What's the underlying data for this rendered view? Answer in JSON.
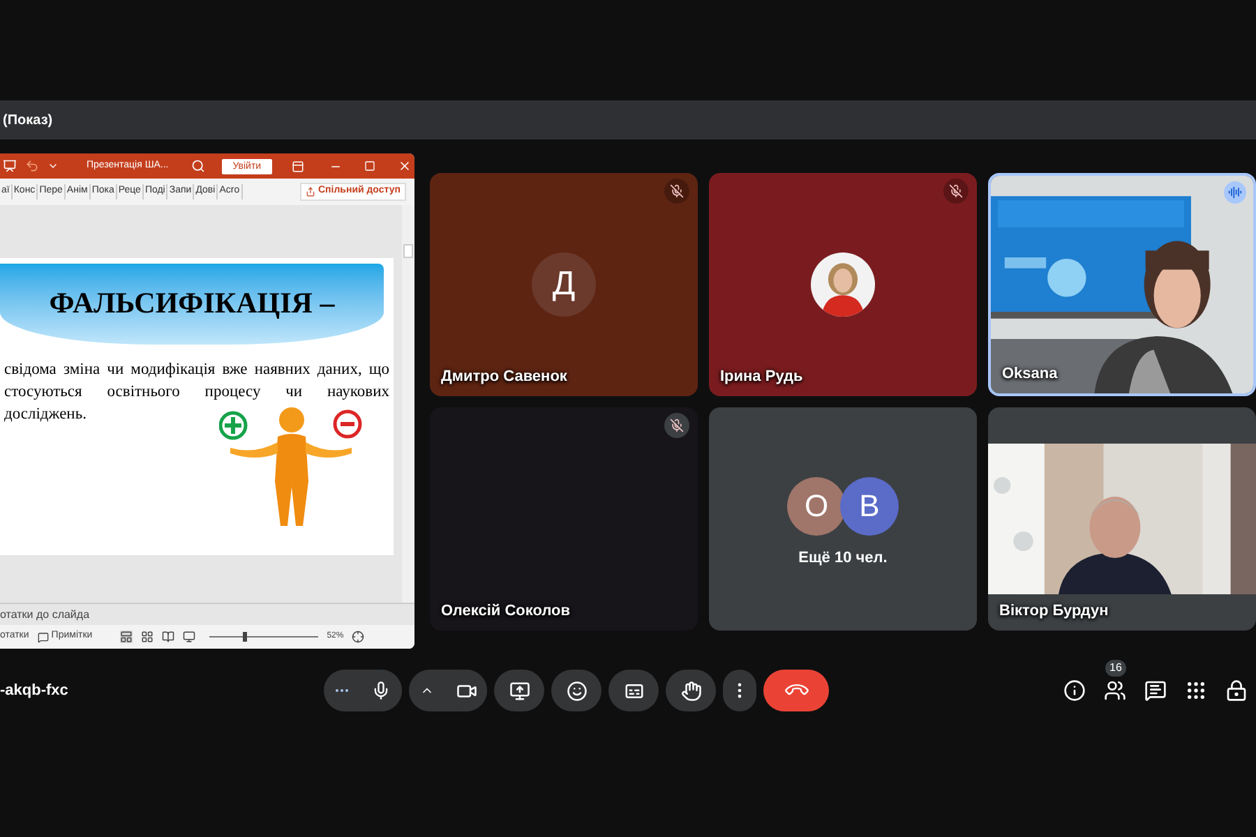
{
  "presentation_bar": {
    "title": "(Показ)"
  },
  "ppt": {
    "title": "Презентація ША...",
    "signin": "Увійти",
    "share": "Спільний доступ",
    "ribbon_tabs": [
      "аї",
      "Конс",
      "Пере",
      "Анім",
      "Пока",
      "Реце",
      "Поді",
      "Запи",
      "Дові",
      "Acro"
    ],
    "slide": {
      "title": "ФАЛЬСИФІКАЦІЯ –",
      "body": "свідома зміна чи модифікація вже наявних даних, що стосуються освітнього процесу чи наукових досліджень."
    },
    "notes_placeholder": "отатки до слайда",
    "status": {
      "notes": "отатки",
      "comments": "Примітки",
      "zoom": "52%",
      "zoom_level": {
        "level": 0.3
      }
    }
  },
  "tiles": [
    {
      "kind": "letter",
      "name": "Дмитро Савенок",
      "letter": "Д",
      "muted": true,
      "speaking": false,
      "color": "#5e2412"
    },
    {
      "name": "Ірина Рудь",
      "muted": true,
      "speaking": false,
      "color": "#7a1c1f"
    },
    {
      "kind": "video",
      "name": "Oksana",
      "muted": false,
      "speaking": true
    },
    {
      "kind": "blank",
      "name": "Олексій Соколов",
      "muted": true,
      "speaking": false
    },
    {
      "kind": "overflow",
      "label": "Ещё 10 чел.",
      "avatars": [
        {
          "letter": "О",
          "color": "#a0756a"
        },
        {
          "letter": "В",
          "color": "#5a6bc8"
        }
      ]
    },
    {
      "kind": "video",
      "name": "Віктор Бурдун",
      "muted": false,
      "speaking": false
    }
  ],
  "meeting_code": "-akqb-fxc",
  "participants_count": "16"
}
